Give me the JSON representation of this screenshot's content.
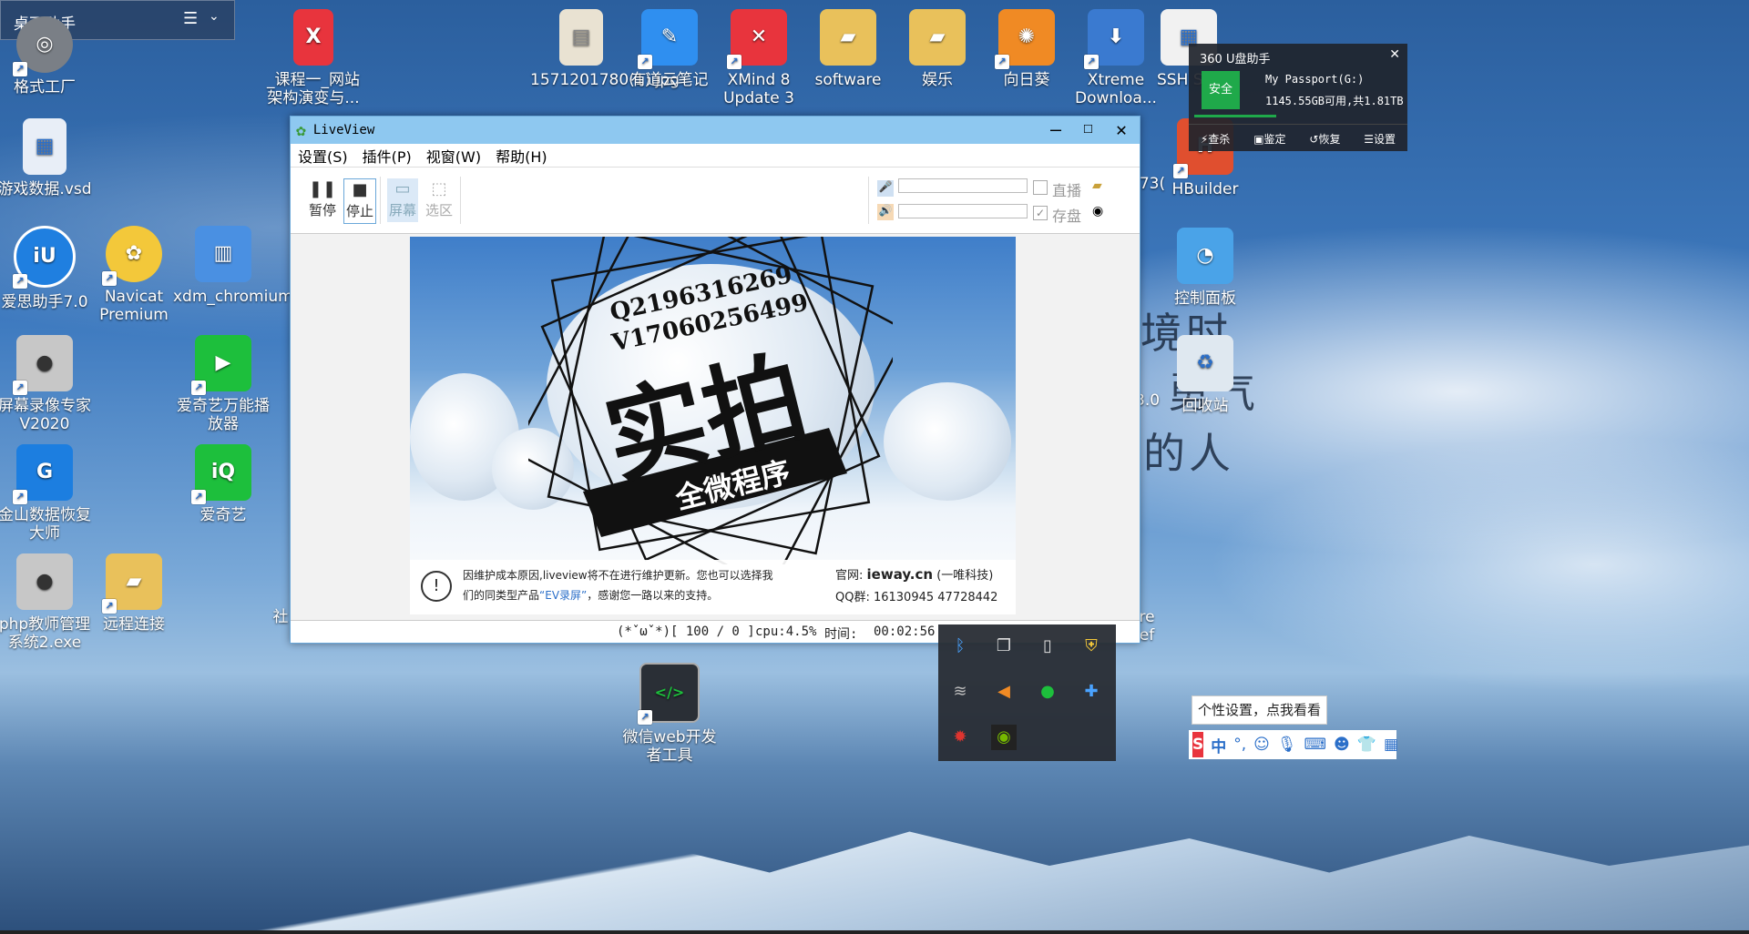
{
  "desktop": {
    "helper_title": "桌面助手",
    "icons": [
      {
        "label": "格式工厂",
        "color": "#7a7f86",
        "glyph": "◎"
      },
      {
        "label": "_课程一_网站架构演变与...",
        "color": "#e8343d",
        "glyph": "X"
      },
      {
        "label": "1571201780(1).jpg",
        "color": "#e9e2d2",
        "glyph": "▤"
      },
      {
        "label": "有道云笔记",
        "color": "#2f8ff0",
        "glyph": "✎"
      },
      {
        "label": "XMind 8 Update 3",
        "color": "#e8343d",
        "glyph": "✕"
      },
      {
        "label": "software",
        "color": "#e9c15b",
        "glyph": "▰"
      },
      {
        "label": "娱乐",
        "color": "#e9c15b",
        "glyph": "▰"
      },
      {
        "label": "向日葵",
        "color": "#f08a24",
        "glyph": "✺"
      },
      {
        "label": "Xtreme Downloa...",
        "color": "#3a7ad0",
        "glyph": "⬇"
      },
      {
        "label": "SSH Shell",
        "color": "#f1f1f1",
        "glyph": "▦"
      },
      {
        "label": "游戏数据.vsd",
        "color": "#e8eef7",
        "glyph": "▦"
      },
      {
        "label": "爱思助手7.0",
        "color": "#1f7fe0",
        "glyph": "iU"
      },
      {
        "label": "Navicat Premium",
        "color": "#f3c83a",
        "glyph": "✿"
      },
      {
        "label": "xdm_chromium.zip",
        "color": "#4a90e2",
        "glyph": "▥"
      },
      {
        "label": "屏幕录像专家V2020",
        "color": "#c7c7c7",
        "glyph": "🎥"
      },
      {
        "label": "爱奇艺万能播放器",
        "color": "#1dbf3c",
        "glyph": "▶"
      },
      {
        "label": "金山数据恢复大师",
        "color": "#1c7ee0",
        "glyph": "G"
      },
      {
        "label": "爱奇艺",
        "color": "#1dbf3c",
        "glyph": "iQ"
      },
      {
        "label": "php教师管理系统2.exe",
        "color": "#c7c7c7",
        "glyph": "🎥"
      },
      {
        "label": "远程连接",
        "color": "#e9c15b",
        "glyph": "▰"
      },
      {
        "label": "HBuilder",
        "color": "#e04f2f",
        "glyph": "H"
      },
      {
        "label": "控制面板",
        "color": "#4aa3e8",
        "glyph": "◔"
      },
      {
        "label": "回收站",
        "color": "#dfe8f0",
        "glyph": "♻"
      },
      {
        "label": "微信web开发者工具",
        "color": "#2a2f36",
        "glyph": "</>"
      }
    ],
    "partial_labels": {
      "left_mid": "社",
      "right_top": "73(",
      "right_mid": "3.0",
      "right_low": "re",
      "right_low2": "ef"
    },
    "calligraphy": [
      "境时",
      "勇气",
      "的人"
    ]
  },
  "liveview": {
    "title": "LiveView",
    "menu": [
      "设置(S)",
      "插件(P)",
      "视窗(W)",
      "帮助(H)"
    ],
    "tools": {
      "pause": "暂停",
      "stop": "停止",
      "screen": "屏幕",
      "region": "选区"
    },
    "options": {
      "live": "直播",
      "save": "存盘"
    },
    "preview": {
      "qq": "Q2196316269",
      "wx": "V17060256499",
      "big": "实拍",
      "ribbon": "全微程序",
      "notice_line1": "因维护成本原因,liveview将不在进行维护更新。您也可以选择我",
      "notice_line2_pre": "们的同类型产品",
      "notice_link": "“EV录屏”",
      "notice_line2_post": "，感谢您一路以来的支持。",
      "site_label": "官网:",
      "site": "ieway.cn",
      "site_company": "(一唯科技)",
      "qq_group": "QQ群: 16130945  47728442"
    },
    "status": {
      "face": "(*ˇωˇ*)[ 100 / 0 ]",
      "cpu": "cpu:4.5%",
      "time_label": "时间:",
      "time": "00:02:56"
    }
  },
  "usb_helper": {
    "title": "360 U盘助手",
    "badge": "安全",
    "device": "My Passport(G:)",
    "space": "1145.55GB可用,共1.81TB",
    "actions": [
      "查杀",
      "鉴定",
      "恢复",
      "设置"
    ]
  },
  "tray": {
    "tooltip": "个性设置，点我看看"
  },
  "ime": {
    "logo": "S",
    "lang": "中"
  }
}
